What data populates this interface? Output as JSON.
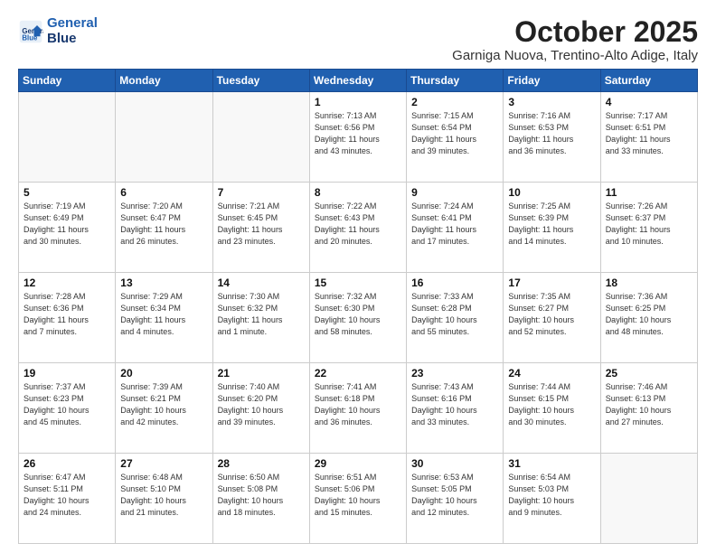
{
  "header": {
    "logo_line1": "General",
    "logo_line2": "Blue",
    "month": "October 2025",
    "location": "Garniga Nuova, Trentino-Alto Adige, Italy"
  },
  "weekdays": [
    "Sunday",
    "Monday",
    "Tuesday",
    "Wednesday",
    "Thursday",
    "Friday",
    "Saturday"
  ],
  "weeks": [
    [
      {
        "day": "",
        "info": ""
      },
      {
        "day": "",
        "info": ""
      },
      {
        "day": "",
        "info": ""
      },
      {
        "day": "1",
        "info": "Sunrise: 7:13 AM\nSunset: 6:56 PM\nDaylight: 11 hours\nand 43 minutes."
      },
      {
        "day": "2",
        "info": "Sunrise: 7:15 AM\nSunset: 6:54 PM\nDaylight: 11 hours\nand 39 minutes."
      },
      {
        "day": "3",
        "info": "Sunrise: 7:16 AM\nSunset: 6:53 PM\nDaylight: 11 hours\nand 36 minutes."
      },
      {
        "day": "4",
        "info": "Sunrise: 7:17 AM\nSunset: 6:51 PM\nDaylight: 11 hours\nand 33 minutes."
      }
    ],
    [
      {
        "day": "5",
        "info": "Sunrise: 7:19 AM\nSunset: 6:49 PM\nDaylight: 11 hours\nand 30 minutes."
      },
      {
        "day": "6",
        "info": "Sunrise: 7:20 AM\nSunset: 6:47 PM\nDaylight: 11 hours\nand 26 minutes."
      },
      {
        "day": "7",
        "info": "Sunrise: 7:21 AM\nSunset: 6:45 PM\nDaylight: 11 hours\nand 23 minutes."
      },
      {
        "day": "8",
        "info": "Sunrise: 7:22 AM\nSunset: 6:43 PM\nDaylight: 11 hours\nand 20 minutes."
      },
      {
        "day": "9",
        "info": "Sunrise: 7:24 AM\nSunset: 6:41 PM\nDaylight: 11 hours\nand 17 minutes."
      },
      {
        "day": "10",
        "info": "Sunrise: 7:25 AM\nSunset: 6:39 PM\nDaylight: 11 hours\nand 14 minutes."
      },
      {
        "day": "11",
        "info": "Sunrise: 7:26 AM\nSunset: 6:37 PM\nDaylight: 11 hours\nand 10 minutes."
      }
    ],
    [
      {
        "day": "12",
        "info": "Sunrise: 7:28 AM\nSunset: 6:36 PM\nDaylight: 11 hours\nand 7 minutes."
      },
      {
        "day": "13",
        "info": "Sunrise: 7:29 AM\nSunset: 6:34 PM\nDaylight: 11 hours\nand 4 minutes."
      },
      {
        "day": "14",
        "info": "Sunrise: 7:30 AM\nSunset: 6:32 PM\nDaylight: 11 hours\nand 1 minute."
      },
      {
        "day": "15",
        "info": "Sunrise: 7:32 AM\nSunset: 6:30 PM\nDaylight: 10 hours\nand 58 minutes."
      },
      {
        "day": "16",
        "info": "Sunrise: 7:33 AM\nSunset: 6:28 PM\nDaylight: 10 hours\nand 55 minutes."
      },
      {
        "day": "17",
        "info": "Sunrise: 7:35 AM\nSunset: 6:27 PM\nDaylight: 10 hours\nand 52 minutes."
      },
      {
        "day": "18",
        "info": "Sunrise: 7:36 AM\nSunset: 6:25 PM\nDaylight: 10 hours\nand 48 minutes."
      }
    ],
    [
      {
        "day": "19",
        "info": "Sunrise: 7:37 AM\nSunset: 6:23 PM\nDaylight: 10 hours\nand 45 minutes."
      },
      {
        "day": "20",
        "info": "Sunrise: 7:39 AM\nSunset: 6:21 PM\nDaylight: 10 hours\nand 42 minutes."
      },
      {
        "day": "21",
        "info": "Sunrise: 7:40 AM\nSunset: 6:20 PM\nDaylight: 10 hours\nand 39 minutes."
      },
      {
        "day": "22",
        "info": "Sunrise: 7:41 AM\nSunset: 6:18 PM\nDaylight: 10 hours\nand 36 minutes."
      },
      {
        "day": "23",
        "info": "Sunrise: 7:43 AM\nSunset: 6:16 PM\nDaylight: 10 hours\nand 33 minutes."
      },
      {
        "day": "24",
        "info": "Sunrise: 7:44 AM\nSunset: 6:15 PM\nDaylight: 10 hours\nand 30 minutes."
      },
      {
        "day": "25",
        "info": "Sunrise: 7:46 AM\nSunset: 6:13 PM\nDaylight: 10 hours\nand 27 minutes."
      }
    ],
    [
      {
        "day": "26",
        "info": "Sunrise: 6:47 AM\nSunset: 5:11 PM\nDaylight: 10 hours\nand 24 minutes."
      },
      {
        "day": "27",
        "info": "Sunrise: 6:48 AM\nSunset: 5:10 PM\nDaylight: 10 hours\nand 21 minutes."
      },
      {
        "day": "28",
        "info": "Sunrise: 6:50 AM\nSunset: 5:08 PM\nDaylight: 10 hours\nand 18 minutes."
      },
      {
        "day": "29",
        "info": "Sunrise: 6:51 AM\nSunset: 5:06 PM\nDaylight: 10 hours\nand 15 minutes."
      },
      {
        "day": "30",
        "info": "Sunrise: 6:53 AM\nSunset: 5:05 PM\nDaylight: 10 hours\nand 12 minutes."
      },
      {
        "day": "31",
        "info": "Sunrise: 6:54 AM\nSunset: 5:03 PM\nDaylight: 10 hours\nand 9 minutes."
      },
      {
        "day": "",
        "info": ""
      }
    ]
  ]
}
